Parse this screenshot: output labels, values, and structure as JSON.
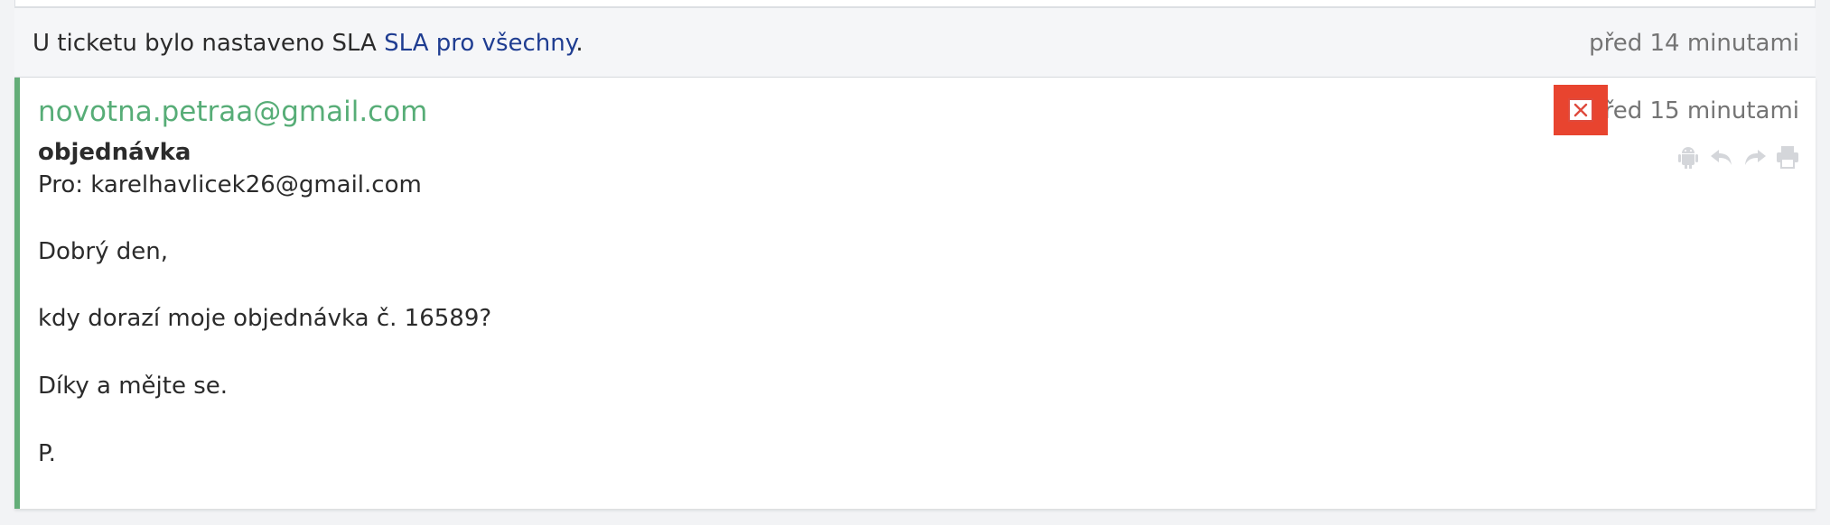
{
  "event": {
    "text_before_link": "U ticketu bylo nastaveno SLA ",
    "link": "SLA pro všechny",
    "text_after_link": ".",
    "time": "před 14 minutami"
  },
  "message": {
    "sender": "novotna.petraa@gmail.com",
    "subject": "objednávka",
    "recipient": "Pro: karelhavlicek26@gmail.com",
    "time": "před 15 minutami",
    "body": [
      "Dobrý den,",
      "kdy dorazí moje objednávka č. 16589?",
      "Díky a mějte se.",
      "P."
    ],
    "icons": {
      "status": "close-box-icon",
      "android": "android-icon",
      "reply": "reply-icon",
      "forward": "forward-icon",
      "print": "print-icon"
    }
  },
  "colors": {
    "accent_green": "#64ad78",
    "link_blue": "#1f3d91",
    "highlight_red": "#e8442f",
    "muted_gray": "#747474"
  }
}
